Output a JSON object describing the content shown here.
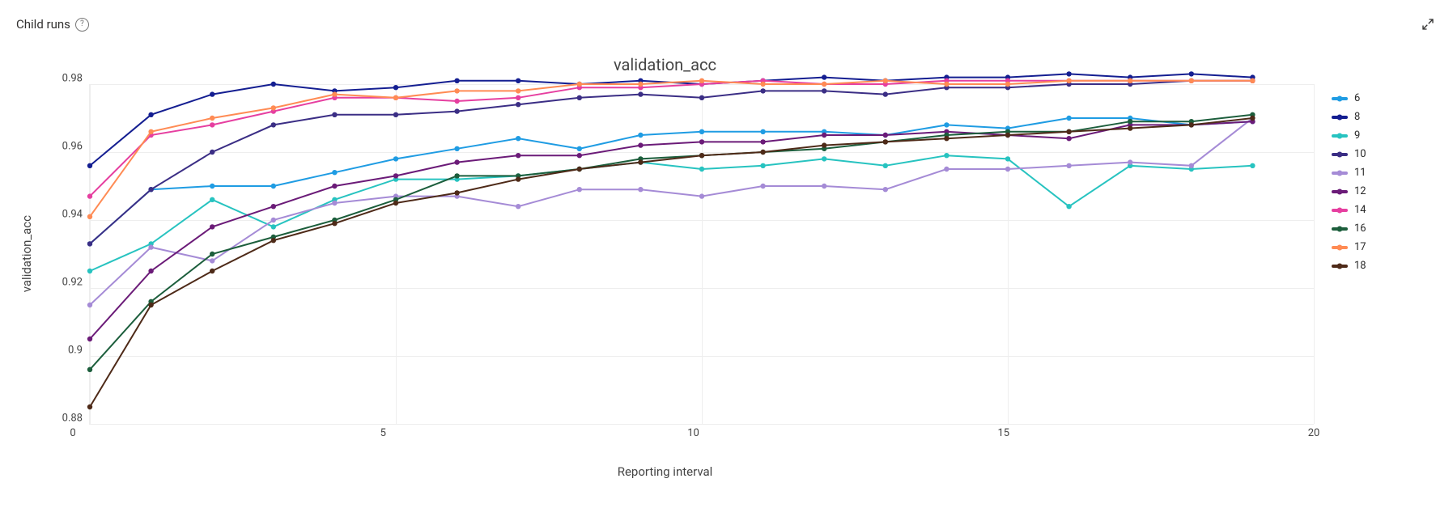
{
  "header": {
    "section_title": "Child runs",
    "help_tooltip": "?",
    "expand_label": "Expand chart"
  },
  "chart_data": {
    "type": "line",
    "title": "validation_acc",
    "xlabel": "Reporting interval",
    "ylabel": "validation_acc",
    "xlim": [
      0,
      20
    ],
    "ylim": [
      0.88,
      0.98
    ],
    "x_ticks": [
      0,
      5,
      10,
      15,
      20
    ],
    "y_ticks": [
      0.88,
      0.9,
      0.92,
      0.94,
      0.96,
      0.98
    ],
    "x": [
      0,
      1,
      2,
      3,
      4,
      5,
      6,
      7,
      8,
      9,
      10,
      11,
      12,
      13,
      14,
      15,
      16,
      17,
      18,
      19
    ],
    "series": [
      {
        "name": "6",
        "color": "#1f9ce3",
        "values": [
          0.933,
          0.949,
          0.95,
          0.95,
          0.954,
          0.958,
          0.961,
          0.964,
          0.961,
          0.965,
          0.966,
          0.966,
          0.966,
          0.965,
          0.968,
          0.967,
          0.97,
          0.97,
          0.968,
          0.969
        ]
      },
      {
        "name": "8",
        "color": "#141e91",
        "values": [
          0.956,
          0.971,
          0.977,
          0.98,
          0.978,
          0.979,
          0.981,
          0.981,
          0.98,
          0.981,
          0.98,
          0.981,
          0.982,
          0.981,
          0.982,
          0.982,
          0.983,
          0.982,
          0.983,
          0.982
        ]
      },
      {
        "name": "9",
        "color": "#27c3c0",
        "values": [
          0.925,
          0.933,
          0.946,
          0.938,
          0.946,
          0.952,
          0.952,
          0.953,
          0.955,
          0.957,
          0.955,
          0.956,
          0.958,
          0.956,
          0.959,
          0.958,
          0.944,
          0.956,
          0.955,
          0.956
        ]
      },
      {
        "name": "10",
        "color": "#3b2e85",
        "values": [
          0.933,
          0.949,
          0.96,
          0.968,
          0.971,
          0.971,
          0.972,
          0.974,
          0.976,
          0.977,
          0.976,
          0.978,
          0.978,
          0.977,
          0.979,
          0.979,
          0.98,
          0.98,
          0.981,
          0.981
        ]
      },
      {
        "name": "11",
        "color": "#a58bd6",
        "values": [
          0.915,
          0.932,
          0.928,
          0.94,
          0.945,
          0.947,
          0.947,
          0.944,
          0.949,
          0.949,
          0.947,
          0.95,
          0.95,
          0.949,
          0.955,
          0.955,
          0.956,
          0.957,
          0.956,
          0.97
        ]
      },
      {
        "name": "12",
        "color": "#6b1b78",
        "values": [
          0.905,
          0.925,
          0.938,
          0.944,
          0.95,
          0.953,
          0.957,
          0.959,
          0.959,
          0.962,
          0.963,
          0.963,
          0.965,
          0.965,
          0.966,
          0.965,
          0.964,
          0.968,
          0.968,
          0.969
        ]
      },
      {
        "name": "14",
        "color": "#e63fa0",
        "values": [
          0.947,
          0.965,
          0.968,
          0.972,
          0.976,
          0.976,
          0.975,
          0.976,
          0.979,
          0.979,
          0.98,
          0.981,
          0.98,
          0.98,
          0.981,
          0.981,
          0.981,
          0.981,
          0.981,
          0.981
        ]
      },
      {
        "name": "16",
        "color": "#1c5e3c",
        "values": [
          0.896,
          0.916,
          0.93,
          0.935,
          0.94,
          0.946,
          0.953,
          0.953,
          0.955,
          0.958,
          0.959,
          0.96,
          0.961,
          0.963,
          0.965,
          0.966,
          0.966,
          0.969,
          0.969,
          0.971
        ]
      },
      {
        "name": "17",
        "color": "#ff8b54",
        "values": [
          0.941,
          0.966,
          0.97,
          0.973,
          0.977,
          0.976,
          0.978,
          0.978,
          0.98,
          0.98,
          0.981,
          0.98,
          0.98,
          0.981,
          0.98,
          0.98,
          0.981,
          0.981,
          0.981,
          0.981
        ]
      },
      {
        "name": "18",
        "color": "#4e2a18",
        "values": [
          0.885,
          0.915,
          0.925,
          0.934,
          0.939,
          0.945,
          0.948,
          0.952,
          0.955,
          0.957,
          0.959,
          0.96,
          0.962,
          0.963,
          0.964,
          0.965,
          0.966,
          0.967,
          0.968,
          0.97
        ]
      }
    ],
    "legend_position": "right",
    "grid": true
  }
}
